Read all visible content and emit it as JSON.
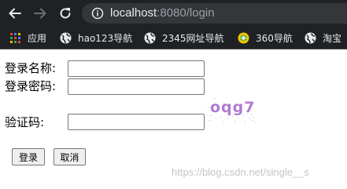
{
  "browser": {
    "url_host": "localhost",
    "url_rest": ":8080/login",
    "bookmarks": [
      {
        "label": "应用",
        "icon": "apps-grid-icon"
      },
      {
        "label": "hao123导航",
        "icon": "globe-icon"
      },
      {
        "label": "2345网址导航",
        "icon": "globe-icon"
      },
      {
        "label": "360导航",
        "icon": "360-logo-icon"
      },
      {
        "label": "淘宝",
        "icon": "globe-icon"
      }
    ]
  },
  "form": {
    "username_label": "登录名称:",
    "username_value": "",
    "password_label": "登录密码:",
    "password_value": "",
    "captcha_label": "验证码:",
    "captcha_value": "",
    "captcha_text": "oqg7"
  },
  "buttons": {
    "login": "登录",
    "cancel": "取消"
  },
  "watermark": "https://blog.csdn.net/single__s"
}
